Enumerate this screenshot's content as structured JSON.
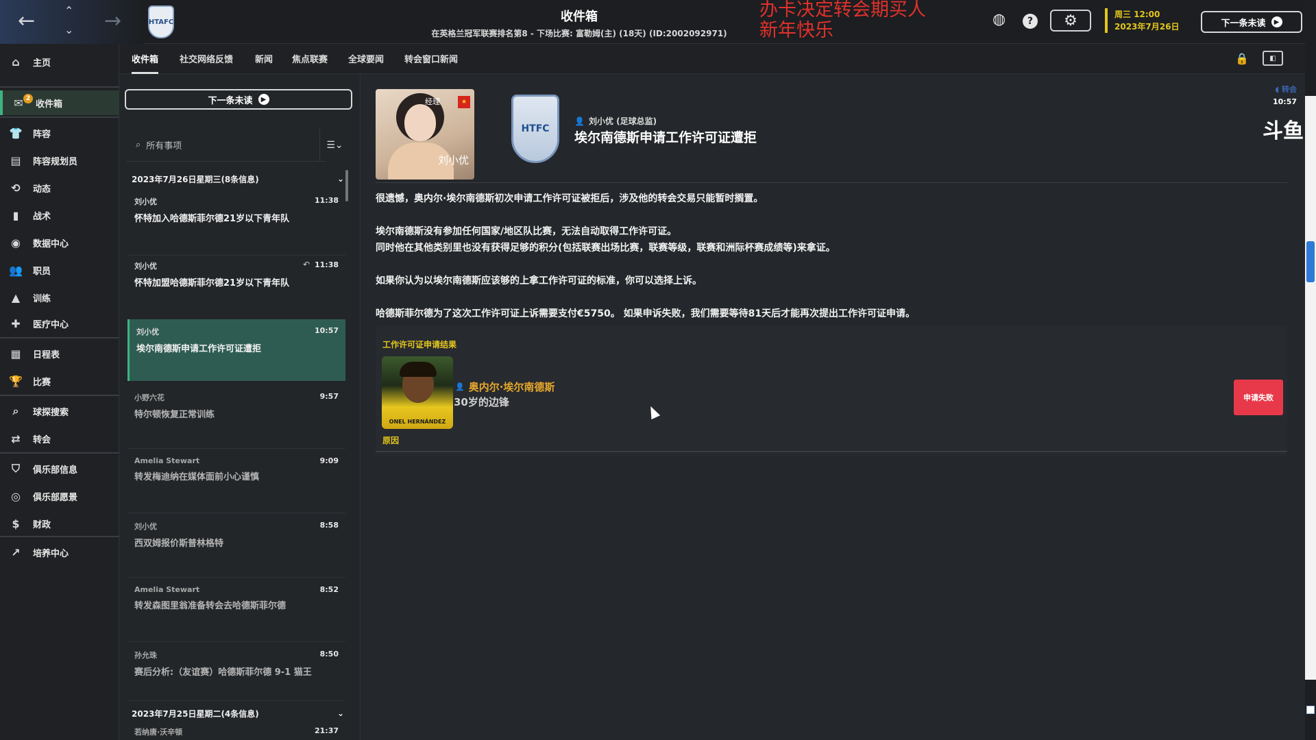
{
  "topbar": {
    "title": "收件箱",
    "subtitle": "在英格兰冠军联赛排名第8 - 下场比赛: 富勒姆(主) (18天) (ID:2002092971)",
    "overlay_line1": "办卡决定转会期买人",
    "overlay_line2": "新年快乐",
    "club_badge_text": "HTAFC",
    "date_line1": "周三 12:00",
    "date_line2": "2023年7月26日",
    "next_unread": "下一条未读",
    "icons": [
      "back-arrow-icon",
      "up-arrow-icon",
      "down-arrow-icon",
      "forward-arrow-icon",
      "globe-icon",
      "help-icon",
      "gear-icon"
    ]
  },
  "sidebar": {
    "inbox_badge": "2",
    "items": [
      {
        "label": "主页",
        "icon": "⌂"
      },
      {
        "label": "收件箱",
        "icon": "✉"
      },
      {
        "label": "阵容",
        "icon": "👕"
      },
      {
        "label": "阵容规划员",
        "icon": "▤"
      },
      {
        "label": "动态",
        "icon": "⟲"
      },
      {
        "label": "战术",
        "icon": "▮"
      },
      {
        "label": "数据中心",
        "icon": "◉"
      },
      {
        "label": "职员",
        "icon": "👥"
      },
      {
        "label": "训练",
        "icon": "▲"
      },
      {
        "label": "医疗中心",
        "icon": "✚"
      },
      {
        "label": "日程表",
        "icon": "▦"
      },
      {
        "label": "比赛",
        "icon": "🏆"
      },
      {
        "label": "球探搜索",
        "icon": "⌕"
      },
      {
        "label": "转会",
        "icon": "⇄"
      },
      {
        "label": "俱乐部信息",
        "icon": "⛉"
      },
      {
        "label": "俱乐部愿景",
        "icon": "◎"
      },
      {
        "label": "财政",
        "icon": "$"
      },
      {
        "label": "培养中心",
        "icon": "↗"
      }
    ]
  },
  "tabs": [
    "收件箱",
    "社交网络反馈",
    "新闻",
    "焦点联赛",
    "全球要闻",
    "转会窗口新闻"
  ],
  "list": {
    "next_unread": "下一条未读",
    "search_placeholder": "所有事项",
    "group1": "2023年7月26日星期三(8条信息)",
    "group2": "2023年7月25日星期二(4条信息)",
    "messages": [
      {
        "sender": "刘小优",
        "time": "11:38",
        "subject": "怀特加入哈德斯菲尔德21岁以下青年队"
      },
      {
        "sender": "刘小优",
        "time": "11:38",
        "subject": "怀特加盟哈德斯菲尔德21岁以下青年队"
      },
      {
        "sender": "刘小优",
        "time": "10:57",
        "subject": "埃尔南德斯申请工作许可证遭拒"
      },
      {
        "sender": "小野六花",
        "time": "9:57",
        "subject": "特尔顿恢复正常训练"
      },
      {
        "sender": "Amelia Stewart",
        "time": "9:09",
        "subject": "转发梅迪纳在媒体面前小心谨慎"
      },
      {
        "sender": "刘小优",
        "time": "8:58",
        "subject": "西双姆报价斯普林格特"
      },
      {
        "sender": "Amelia Stewart",
        "time": "8:52",
        "subject": "转发森图里翁准备转会去哈德斯菲尔德"
      },
      {
        "sender": "孙允珠",
        "time": "8:50",
        "subject": "赛后分析:（友谊赛）哈德斯菲尔德 9-1 猫王"
      }
    ],
    "next_sender": "若纳唐·沃辛顿",
    "next_time": "21:37"
  },
  "detail": {
    "photo_name": "刘小优",
    "photo_tag": "经理",
    "crest_text": "HTFC",
    "from": "刘小优 (足球总监)",
    "subject": "埃尔南德斯申请工作许可证遭拒",
    "meta_tag": "转会",
    "meta_time": "10:57",
    "watermark": "斗鱼",
    "paragraphs": [
      "很遗憾，奥内尔·埃尔南德斯初次申请工作许可证被拒后，涉及他的转会交易只能暂时搁置。",
      "埃尔南德斯没有参加任何国家/地区队比赛，无法自动取得工作许可证。",
      "同时他在其他类别里也没有获得足够的积分(包括联赛出场比赛，联赛等级，联赛和洲际杯赛成绩等)来拿证。",
      "如果你认为以埃尔南德斯应该够的上拿工作许可证的标准，你可以选择上诉。",
      "哈德斯菲尔德为了这次工作许可证上诉需要支付€5750。 如果申诉失败，我们需要等待81天后才能再次提出工作许可证申请。"
    ],
    "result_title": "工作许可证申请结果",
    "player_name": "奥内尔·埃尔南德斯",
    "player_desc": "30岁的边锋",
    "player_caption": "ONEL HERNÁNDEZ",
    "status": "申请失败",
    "reason_label": "原因"
  },
  "colors": {
    "accent": "#3fb37f",
    "active_msg": "#2f5c52",
    "yellow": "#e3c61e",
    "fail": "#e8394a",
    "overlay_red": "#e0312c"
  }
}
